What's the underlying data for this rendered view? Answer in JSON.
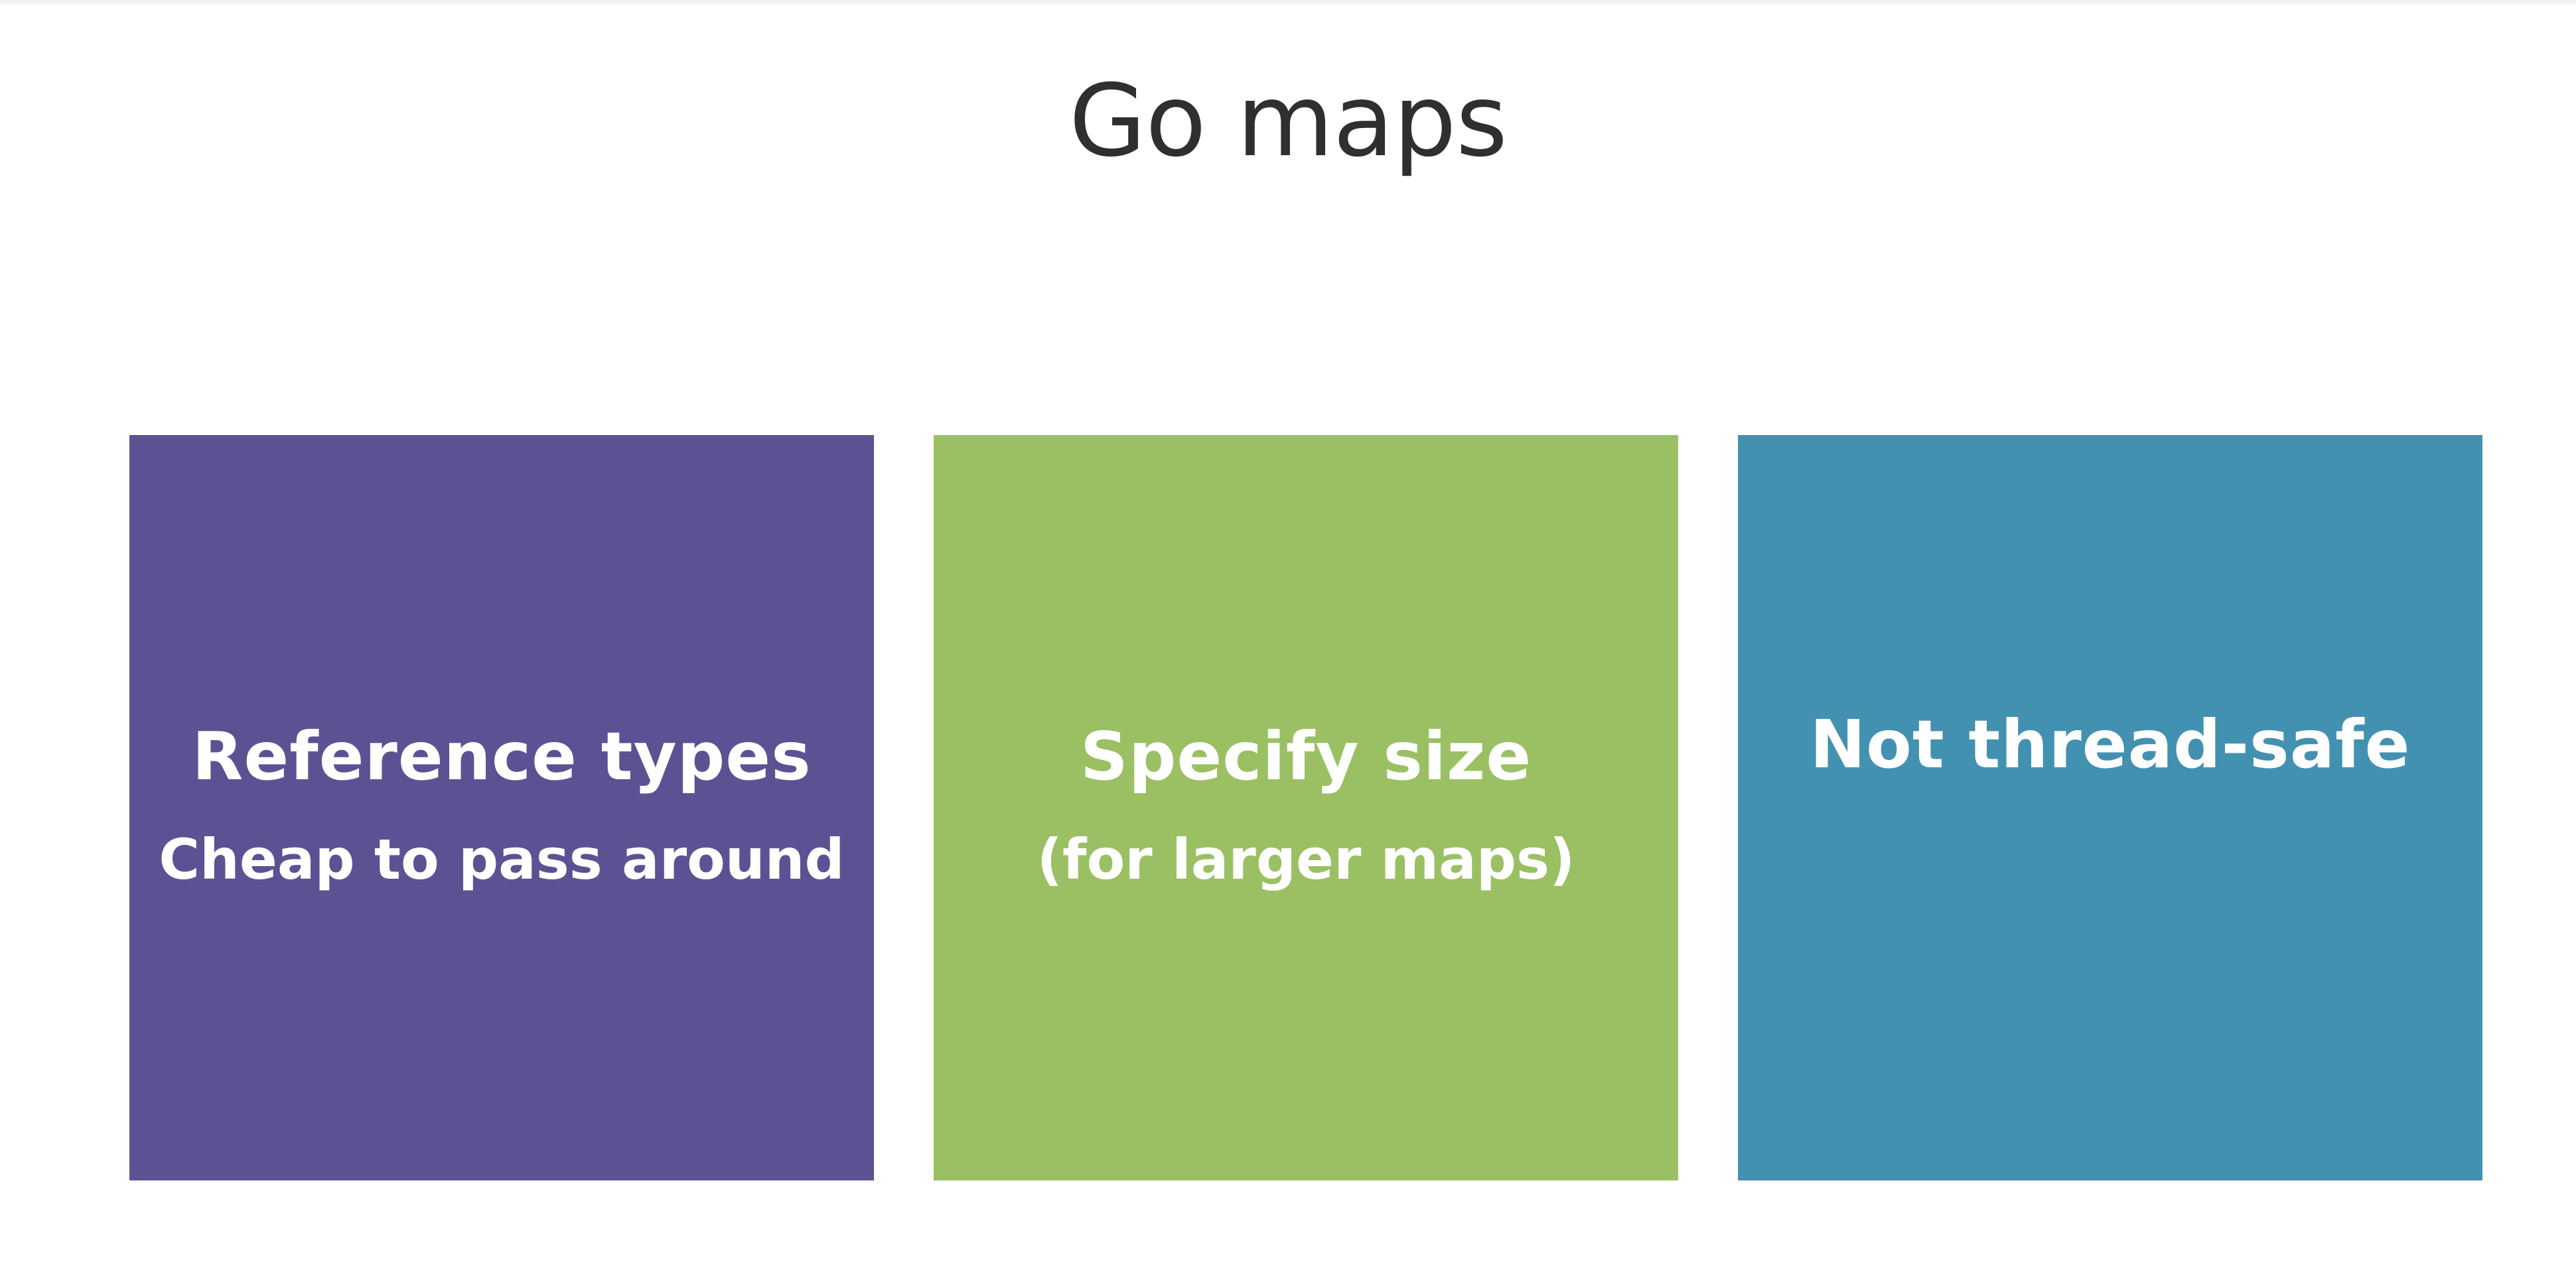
{
  "slide": {
    "title": "Go maps"
  },
  "cards": [
    {
      "heading": "Reference types",
      "subtext": "Cheap to pass around",
      "color": "#5c5293"
    },
    {
      "heading": "Specify size",
      "subtext": "(for larger maps)",
      "color": "#9bc064"
    },
    {
      "heading": "Not thread-safe",
      "subtext": "",
      "color": "#4391b1"
    }
  ]
}
